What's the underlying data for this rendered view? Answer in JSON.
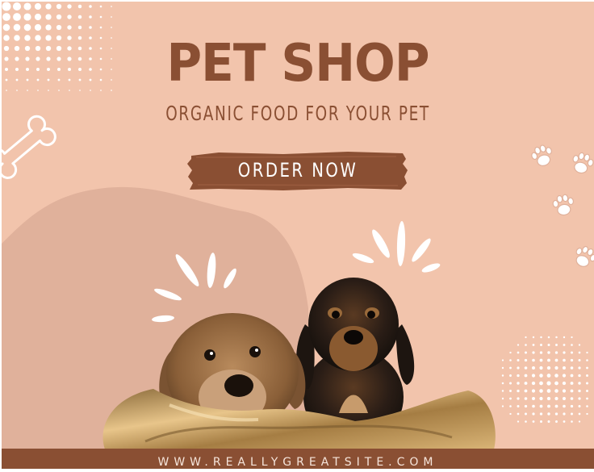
{
  "headline": "PET SHOP",
  "subheadline": "ORGANIC FOOD FOR YOUR PET",
  "cta": {
    "label": "ORDER NOW"
  },
  "footer": {
    "website": "WWW.REALLYGREATSITE.COM"
  },
  "icons": [
    "bone-icon",
    "paw-print-icon",
    "sparkle-burst-icon"
  ],
  "colors": {
    "background": "#f2c4ac",
    "accent_brown": "#8a4f33",
    "blob": "#e0b19b",
    "white": "#ffffff"
  }
}
